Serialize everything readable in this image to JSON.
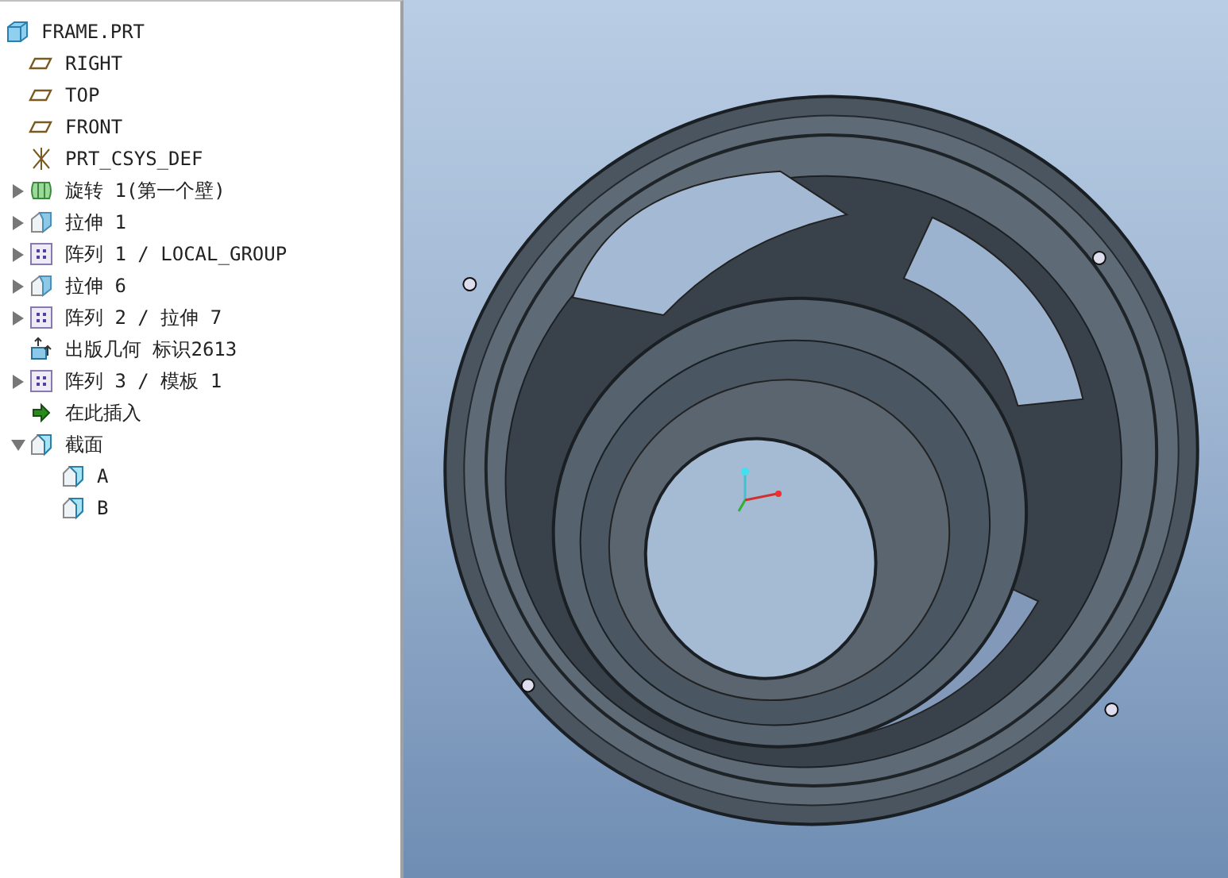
{
  "model_tree": {
    "root": {
      "label": "FRAME.PRT",
      "kind": "part"
    },
    "items": [
      {
        "label": "RIGHT",
        "kind": "plane"
      },
      {
        "label": "TOP",
        "kind": "plane"
      },
      {
        "label": "FRONT",
        "kind": "plane"
      },
      {
        "label": "PRT_CSYS_DEF",
        "kind": "csys"
      },
      {
        "label": "旋转 1(第一个壁)",
        "kind": "revolve",
        "expanded": false
      },
      {
        "label": "拉伸 1",
        "kind": "extrude",
        "expanded": false
      },
      {
        "label": "阵列 1 / LOCAL_GROUP",
        "kind": "pattern",
        "expanded": false
      },
      {
        "label": "拉伸 6",
        "kind": "extrude",
        "expanded": false
      },
      {
        "label": "阵列 2 / 拉伸 7",
        "kind": "pattern",
        "expanded": false
      },
      {
        "label": "出版几何 标识2613",
        "kind": "publish"
      },
      {
        "label": "阵列 3 / 模板 1",
        "kind": "pattern",
        "expanded": false
      },
      {
        "label": "在此插入",
        "kind": "insert"
      },
      {
        "label": "截面",
        "kind": "sections",
        "expanded": true,
        "children": [
          {
            "label": "A",
            "kind": "section"
          },
          {
            "label": "B",
            "kind": "section"
          }
        ]
      }
    ]
  }
}
